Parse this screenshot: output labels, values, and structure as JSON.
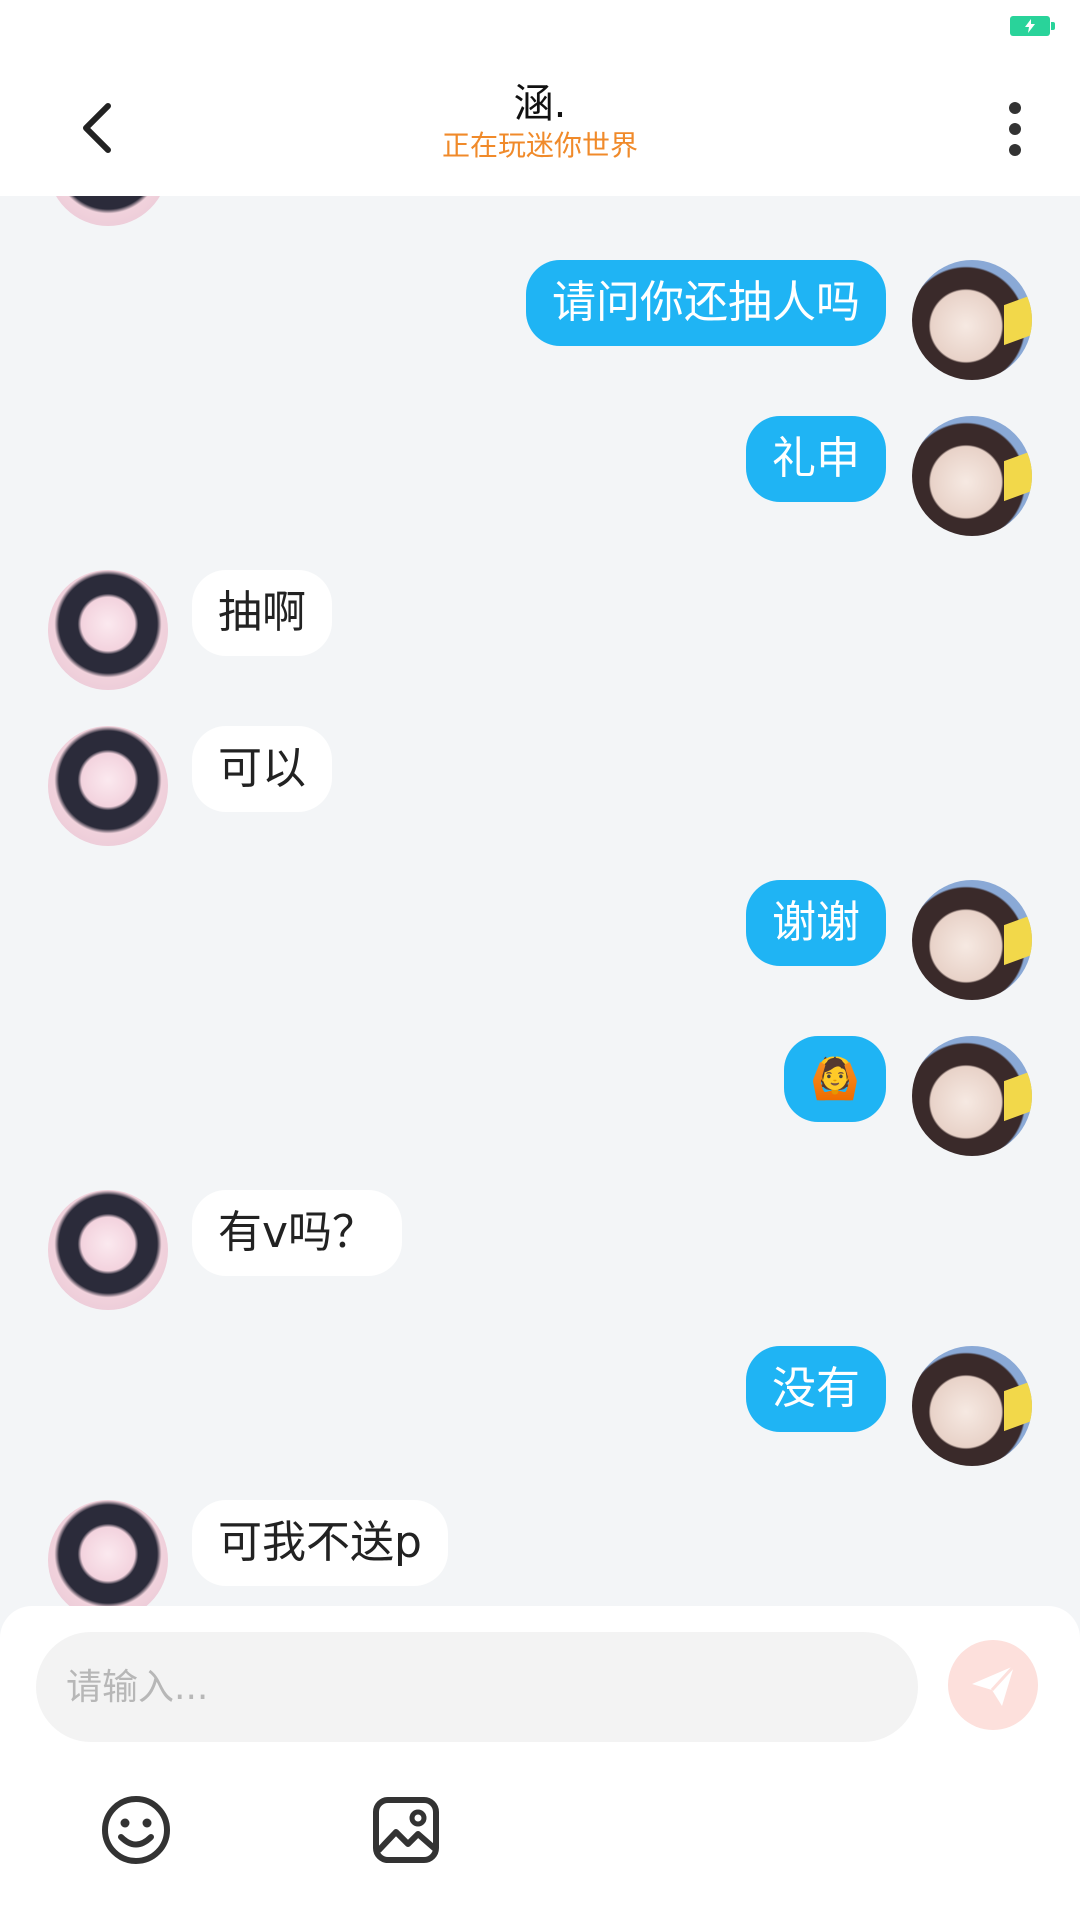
{
  "header": {
    "title": "涵.",
    "subtitle": "正在玩迷你世界"
  },
  "colors": {
    "accent": "#1fb4f4",
    "subtitle": "#f08a2a",
    "battery": "#29d39a",
    "send_button": "#fde0dc"
  },
  "messages": [
    {
      "side": "self",
      "text": "请问你还抽人吗"
    },
    {
      "side": "self",
      "text": "礼申"
    },
    {
      "side": "other",
      "text": "抽啊"
    },
    {
      "side": "other",
      "text": "可以"
    },
    {
      "side": "self",
      "text": "谢谢"
    },
    {
      "side": "self",
      "text": "🙆"
    },
    {
      "side": "other",
      "text": "有v吗？"
    },
    {
      "side": "self",
      "text": "没有"
    },
    {
      "side": "other",
      "text": "可我不送p"
    }
  ],
  "input": {
    "placeholder": "请输入..."
  },
  "icons": {
    "back": "chevron-left-icon",
    "more": "more-vertical-icon",
    "send": "paper-plane-icon",
    "emoji": "smiley-icon",
    "image": "image-icon",
    "battery": "battery-charging-icon"
  }
}
